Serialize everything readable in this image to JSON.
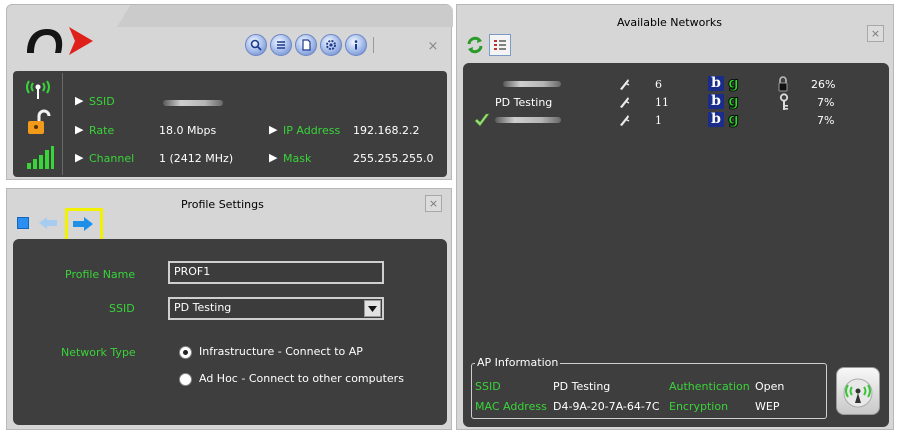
{
  "status_panel": {
    "labels": {
      "ssid": "SSID",
      "rate": "Rate",
      "channel": "Channel",
      "ip_address": "IP Address",
      "mask": "Mask"
    },
    "values": {
      "rate": "18.0 Mbps",
      "channel": "1 (2412 MHz)",
      "ip_address": "192.168.2.2",
      "mask": "255.255.255.0"
    },
    "toolbar_icons": [
      "search-icon",
      "list-icon",
      "page-icon",
      "gear-icon",
      "info-icon"
    ],
    "close_label": "×"
  },
  "profile_settings": {
    "title": "Profile Settings",
    "close_label": "×",
    "toolbar_icons": [
      "stop-icon",
      "back-arrow-icon",
      "forward-arrow-icon"
    ],
    "fields": {
      "profile_name_label": "Profile Name",
      "profile_name_value": "PROF1",
      "ssid_label": "SSID",
      "ssid_value": "PD Testing",
      "network_type_label": "Network Type"
    },
    "network_type_options": [
      {
        "label": "Infrastructure - Connect to AP",
        "selected": true
      },
      {
        "label": "Ad Hoc - Connect to other computers",
        "selected": false
      }
    ]
  },
  "available_networks": {
    "title": "Available Networks",
    "close_label": "×",
    "networks": [
      {
        "name": "",
        "channel": "6",
        "mode_b": "b",
        "mode_g": "g",
        "security": "lock",
        "signal": "26%",
        "connected": false
      },
      {
        "name": "PD Testing",
        "channel": "11",
        "mode_b": "b",
        "mode_g": "g",
        "security": "key",
        "signal": "7%",
        "connected": false
      },
      {
        "name": "",
        "channel": "1",
        "mode_b": "b",
        "mode_g": "g",
        "security": "",
        "signal": "7%",
        "connected": true
      }
    ],
    "ap_info": {
      "legend": "AP Information",
      "ssid_label": "SSID",
      "ssid_value": "PD Testing",
      "mac_label": "MAC Address",
      "mac_value": "D4-9A-20-7A-64-7C",
      "auth_label": "Authentication",
      "auth_value": "Open",
      "enc_label": "Encryption",
      "enc_value": "WEP"
    }
  },
  "colors": {
    "label_green": "#39d439",
    "panel_dark": "#3e3e3e",
    "brand_red": "#e0201a",
    "highlight_yellow": "#f2f200"
  }
}
